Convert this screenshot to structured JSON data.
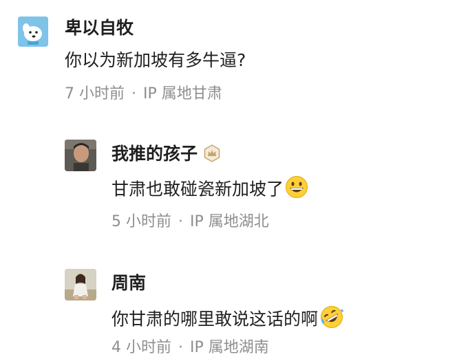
{
  "comments": [
    {
      "username": "卑以自牧",
      "text": "你以为新加坡有多牛逼?",
      "time": "7 小时前",
      "separator": "·",
      "ip": "IP 属地甘肃",
      "avatar_icon": "cartoon-dog-avatar"
    },
    {
      "username": "我推的孩子",
      "badge_icon": "crown-badge-icon",
      "text": "甘肃也敢碰瓷新加坡了",
      "emoji": "grinning-face-emoji",
      "time": "5 小时前",
      "separator": "·",
      "ip": "IP 属地湖北",
      "avatar_icon": "man-photo-avatar"
    },
    {
      "username": "周南",
      "text": "你甘肃的哪里敢说这话的啊",
      "emoji": "rolling-on-floor-laughing-emoji",
      "time": "4 小时前",
      "separator": "·",
      "ip": "IP 属地湖南",
      "avatar_icon": "woman-photo-avatar"
    }
  ],
  "colors": {
    "text": "#1f1f1f",
    "meta": "#8e8e8e",
    "badge": "#c9a46a"
  }
}
